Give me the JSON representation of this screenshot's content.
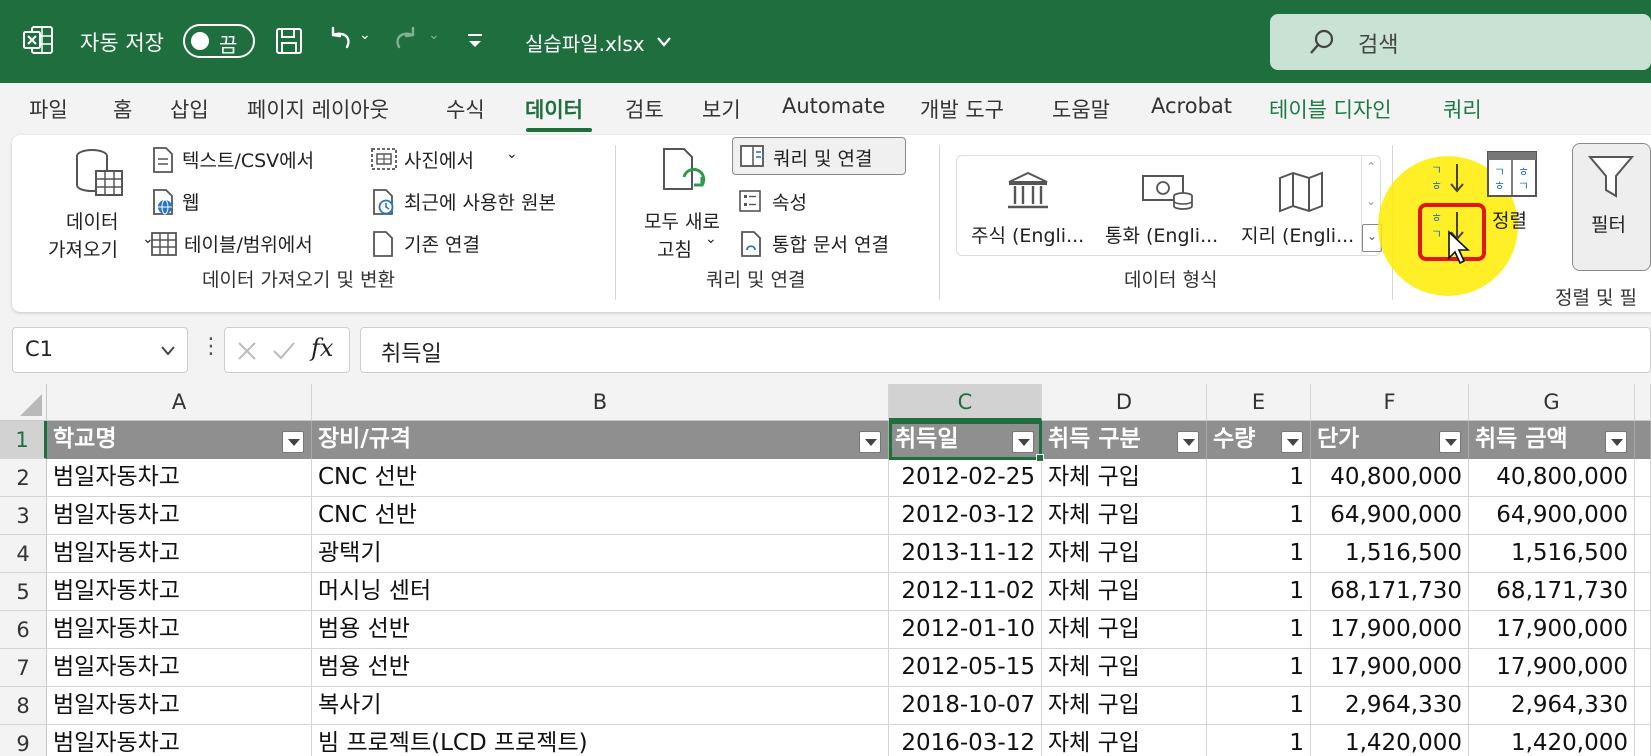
{
  "titlebar": {
    "app_icon": "excel-icon",
    "autosave_label": "자동 저장",
    "autosave_state": "끔",
    "filename": "실습파일.xlsx",
    "search_placeholder": "검색"
  },
  "ribbon_tabs": [
    {
      "label": "파일"
    },
    {
      "label": "홈"
    },
    {
      "label": "삽입"
    },
    {
      "label": "페이지 레이아웃"
    },
    {
      "label": "수식"
    },
    {
      "label": "데이터",
      "active": true
    },
    {
      "label": "검토"
    },
    {
      "label": "보기"
    },
    {
      "label": "Automate"
    },
    {
      "label": "개발 도구"
    },
    {
      "label": "도움말"
    },
    {
      "label": "Acrobat"
    },
    {
      "label": "테이블 디자인"
    },
    {
      "label": "쿼리"
    }
  ],
  "ribbon": {
    "get_data": {
      "big_button_line1": "데이터",
      "big_button_line2": "가져오기",
      "from_text_csv": "텍스트/CSV에서",
      "from_web": "웹",
      "from_table_range": "테이블/범위에서",
      "from_picture": "사진에서",
      "recent_sources": "최근에 사용한 원본",
      "existing_connections": "기존 연결",
      "group_label": "데이터 가져오기 및 변환"
    },
    "queries": {
      "refresh_all_line1": "모두 새로",
      "refresh_all_line2": "고침",
      "queries_connections": "쿼리 및 연결",
      "properties": "속성",
      "edit_links": "통합 문서 연결",
      "group_label": "쿼리 및 연결"
    },
    "data_types": {
      "stocks": "주식 (Engli...",
      "currencies": "통화 (Engli...",
      "geography": "지리 (Engli...",
      "group_label": "데이터 형식"
    },
    "sort_filter": {
      "sort": "정렬",
      "filter": "필터",
      "group_label": "정렬 및 필"
    }
  },
  "formula_bar": {
    "name_box": "C1",
    "fx": "fx",
    "content": "취득일"
  },
  "grid": {
    "columns": [
      "A",
      "B",
      "C",
      "D",
      "E",
      "F",
      "G"
    ],
    "header_row": [
      "학교명",
      "장비/규격",
      "취득일",
      "취득 구분",
      "수량",
      "단가",
      "취득 금액"
    ],
    "rows": [
      {
        "num": "1"
      },
      {
        "num": "2",
        "cells": [
          "범일자동차고",
          "CNC 선반",
          "2012-02-25",
          "자체 구입",
          "1",
          "40,800,000",
          "40,800,000"
        ]
      },
      {
        "num": "3",
        "cells": [
          "범일자동차고",
          "CNC 선반",
          "2012-03-12",
          "자체 구입",
          "1",
          "64,900,000",
          "64,900,000"
        ]
      },
      {
        "num": "4",
        "cells": [
          "범일자동차고",
          "광택기",
          "2013-11-12",
          "자체 구입",
          "1",
          "1,516,500",
          "1,516,500"
        ]
      },
      {
        "num": "5",
        "cells": [
          "범일자동차고",
          "머시닝 센터",
          "2012-11-02",
          "자체 구입",
          "1",
          "68,171,730",
          "68,171,730"
        ]
      },
      {
        "num": "6",
        "cells": [
          "범일자동차고",
          "범용 선반",
          "2012-01-10",
          "자체 구입",
          "1",
          "17,900,000",
          "17,900,000"
        ]
      },
      {
        "num": "7",
        "cells": [
          "범일자동차고",
          "범용 선반",
          "2012-05-15",
          "자체 구입",
          "1",
          "17,900,000",
          "17,900,000"
        ]
      },
      {
        "num": "8",
        "cells": [
          "범일자동차고",
          "복사기",
          "2018-10-07",
          "자체 구입",
          "1",
          "2,964,330",
          "2,964,330"
        ]
      },
      {
        "num": "9",
        "cells": [
          "범일자동차고",
          "빔 프로젝트(LCD 프로젝트)",
          "2016-03-12",
          "자체 구입",
          "1",
          "1,420,000",
          "1,420,000"
        ]
      }
    ]
  },
  "colors": {
    "excel_green": "#1e6e3e",
    "table_header_bg": "#8f8f8f",
    "highlight_yellow": "#ffec00",
    "annotation_red": "#e0161b"
  }
}
